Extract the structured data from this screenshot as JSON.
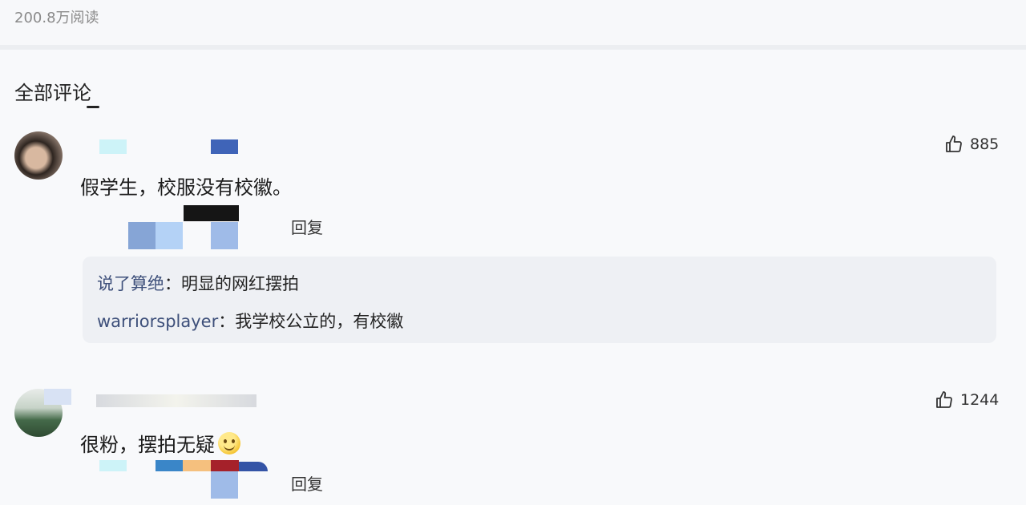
{
  "header": {
    "read_count": "200.8万阅读"
  },
  "comments_section": {
    "title": "全部评论",
    "comments": [
      {
        "text": "假学生，校服没有校徽。",
        "likes": "885",
        "reply_label": "回复",
        "replies": [
          {
            "user": "说了算绝",
            "separator": "：",
            "text": "明显的网红摆拍"
          },
          {
            "user": "warriorsplayer",
            "separator": "：",
            "text": "我学校公立的，有校徽"
          }
        ]
      },
      {
        "text": "很粉，摆拍无疑",
        "emoji": "smile-emoji",
        "likes": "1244",
        "reply_label": "回复"
      }
    ]
  },
  "icons": {
    "like": "thumbs-up-icon"
  }
}
